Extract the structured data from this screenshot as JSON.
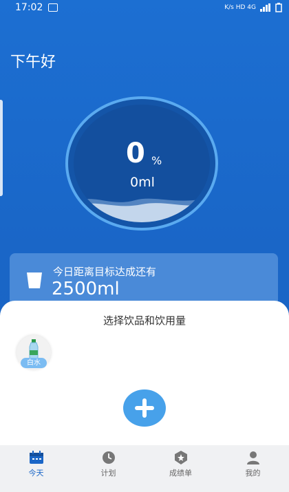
{
  "status_bar": {
    "time": "17:02",
    "indicators": "K/s  HD  4G"
  },
  "greeting": "下午好",
  "progress": {
    "percent_value": "0",
    "percent_sign": "%",
    "volume": "0ml"
  },
  "goal": {
    "label": "今日距离目标达成还有",
    "remaining": "2500ml"
  },
  "sheet": {
    "title": "选择饮品和饮用量",
    "drinks": [
      {
        "label": "白水",
        "icon": "water-bottle-icon"
      }
    ],
    "add_icon": "plus-icon"
  },
  "nav": {
    "items": [
      {
        "label": "今天",
        "icon": "calendar-icon",
        "active": true
      },
      {
        "label": "计划",
        "icon": "clock-icon",
        "active": false
      },
      {
        "label": "成绩单",
        "icon": "badge-icon",
        "active": false
      },
      {
        "label": "我的",
        "icon": "user-icon",
        "active": false
      }
    ]
  },
  "colors": {
    "primary": "#1a66c7",
    "accent": "#47a1ea",
    "ring": "#5aaaf0"
  }
}
